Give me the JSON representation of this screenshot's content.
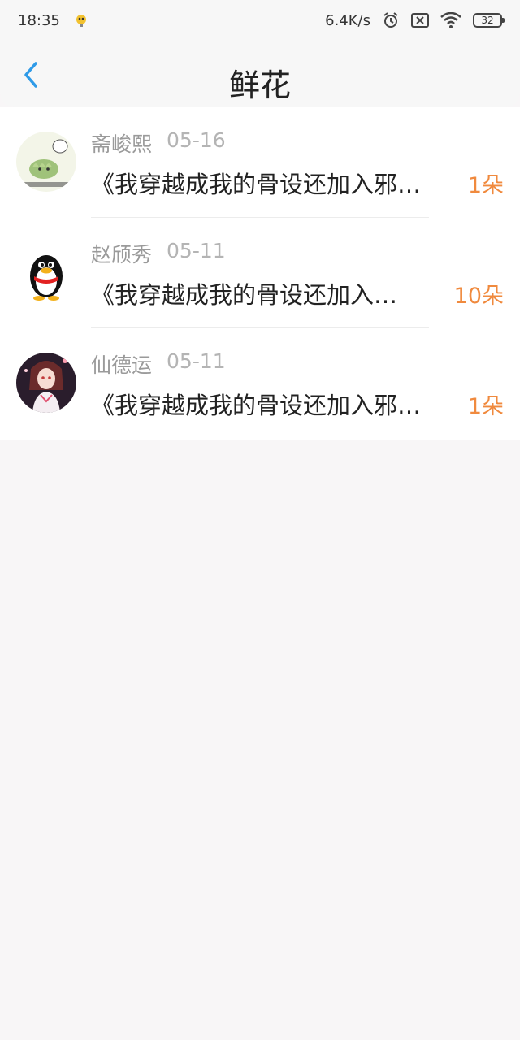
{
  "status_bar": {
    "time": "18:35",
    "network_speed": "6.4K/s",
    "battery": "32",
    "icons": [
      "notification-bird-icon",
      "alarm-icon",
      "no-sim-icon",
      "wifi-icon",
      "battery-icon"
    ]
  },
  "header": {
    "title": "鲜花",
    "back_icon": "chevron-left-icon"
  },
  "items": [
    {
      "name": "斋峻熙",
      "date": "05-16",
      "book": "《我穿越成我的骨设还加入邪…",
      "count": "1朵"
    },
    {
      "name": "赵颀秀",
      "date": "05-11",
      "book": "《我穿越成我的骨设还加入…",
      "count": "10朵"
    },
    {
      "name": "仙德运",
      "date": "05-11",
      "book": "《我穿越成我的骨设还加入邪…",
      "count": "1朵"
    }
  ],
  "colors": {
    "accent_blue": "#2f9be8",
    "count_orange": "#f08a3e",
    "muted_gray": "#9a9a9a"
  }
}
